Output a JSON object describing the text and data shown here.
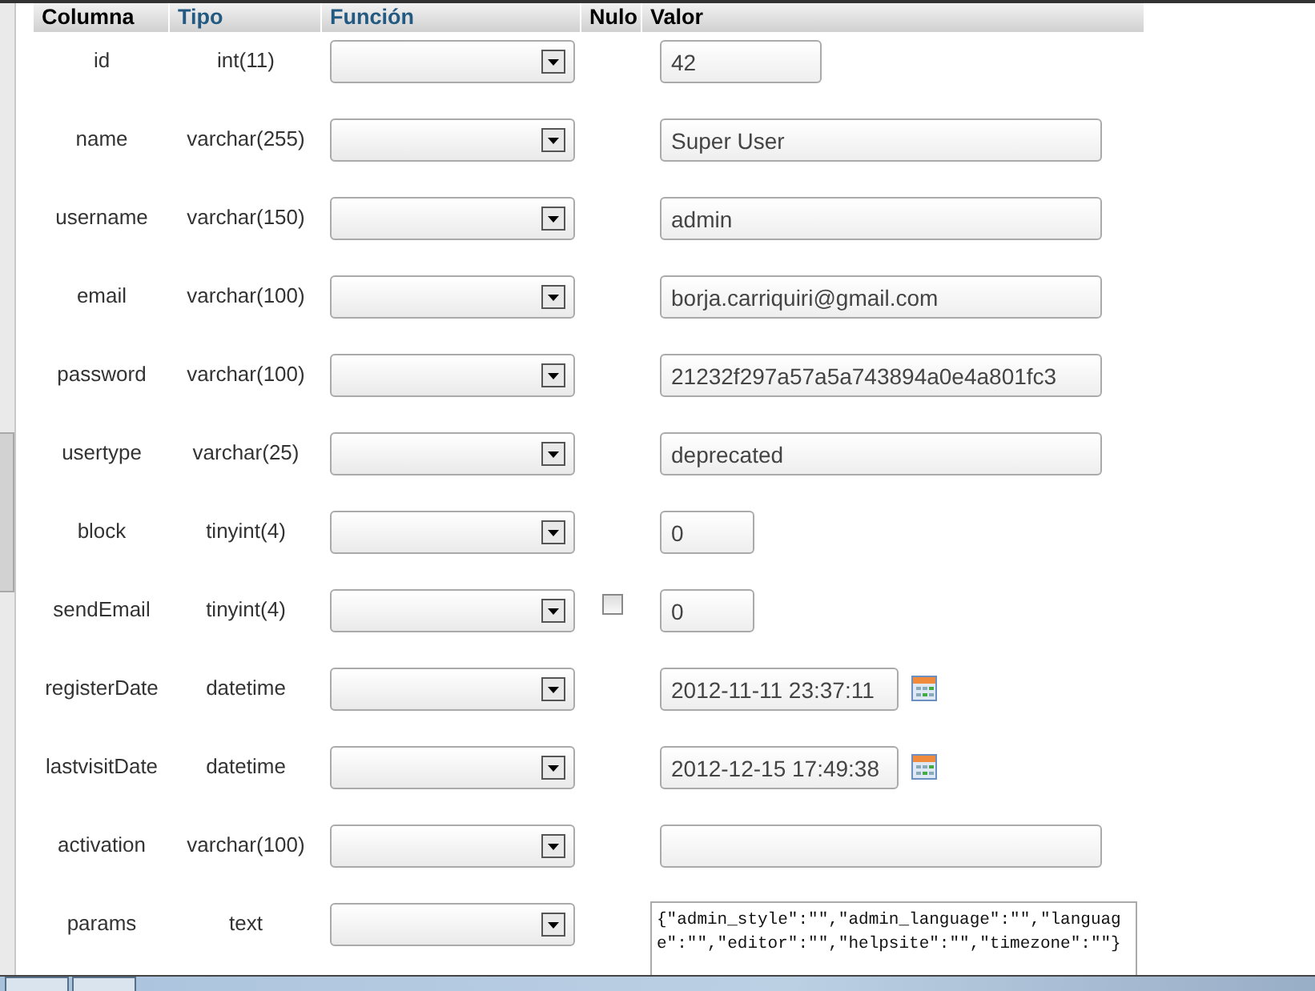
{
  "columns": [
    {
      "label": "Columna",
      "kind": "plain"
    },
    {
      "label": "Tipo",
      "kind": "link"
    },
    {
      "label": "Función",
      "kind": "link"
    },
    {
      "label": "Nulo",
      "kind": "plain"
    },
    {
      "label": "Valor",
      "kind": "plain"
    }
  ],
  "rows": [
    {
      "column": "id",
      "type": "int(11)",
      "kind": "short",
      "value": "42"
    },
    {
      "column": "name",
      "type": "varchar(255)",
      "kind": "long",
      "value": "Super User"
    },
    {
      "column": "username",
      "type": "varchar(150)",
      "kind": "long",
      "value": "admin"
    },
    {
      "column": "email",
      "type": "varchar(100)",
      "kind": "long",
      "value": "borja.carriquiri@gmail.com"
    },
    {
      "column": "password",
      "type": "varchar(100)",
      "kind": "long",
      "value": "21232f297a57a5a743894a0e4a801fc3"
    },
    {
      "column": "usertype",
      "type": "varchar(25)",
      "kind": "long",
      "value": "deprecated"
    },
    {
      "column": "block",
      "type": "tinyint(4)",
      "kind": "tiny",
      "value": "0"
    },
    {
      "column": "sendEmail",
      "type": "tinyint(4)",
      "kind": "tiny",
      "value": "0",
      "null_checkbox": {
        "checked": false
      }
    },
    {
      "column": "registerDate",
      "type": "datetime",
      "kind": "date",
      "value": "2012-11-11 23:37:11"
    },
    {
      "column": "lastvisitDate",
      "type": "datetime",
      "kind": "date",
      "value": "2012-12-15 17:49:38"
    },
    {
      "column": "activation",
      "type": "varchar(100)",
      "kind": "long",
      "value": ""
    },
    {
      "column": "params",
      "type": "text",
      "kind": "textarea",
      "value": "{\"admin_style\":\"\",\"admin_language\":\"\",\"language\":\"\",\"editor\":\"\",\"helpsite\":\"\",\"timezone\":\"\"}"
    }
  ]
}
